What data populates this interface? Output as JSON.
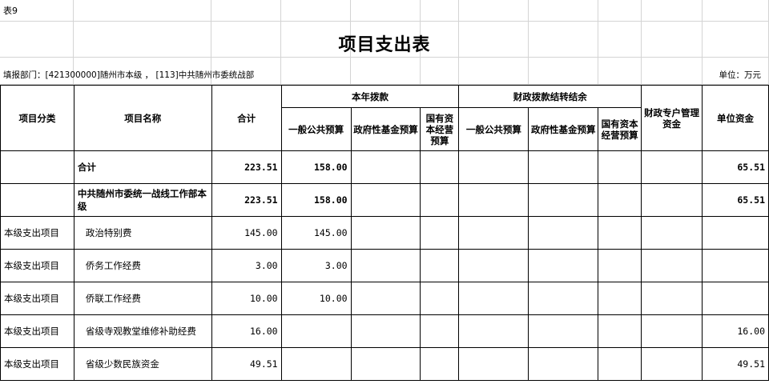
{
  "sheet_label": "表9",
  "title": "项目支出表",
  "dept": "填报部门：[421300000]随州市本级 ， [113]中共随州市委统战部",
  "unit": "单位：万元",
  "headers": {
    "category": "项目分类",
    "name": "项目名称",
    "total": "合计",
    "current_year": "本年拨款",
    "carryover": "财政拨款结转结余",
    "general": "一般公共预算",
    "gov_fund": "政府性基金预算",
    "state_capital": "国有资本经营预算",
    "special": "财政专户管理资金",
    "unit_funds": "单位资金"
  },
  "rows": [
    {
      "category": "",
      "name": "合计",
      "total": "223.51",
      "general": "158.00",
      "gov_fund": "",
      "state_capital": "",
      "co_general": "",
      "co_gov_fund": "",
      "co_state_capital": "",
      "special": "",
      "unit_funds": "65.51"
    },
    {
      "category": "",
      "name": "中共随州市委统一战线工作部本级",
      "total": "223.51",
      "general": "158.00",
      "gov_fund": "",
      "state_capital": "",
      "co_general": "",
      "co_gov_fund": "",
      "co_state_capital": "",
      "special": "",
      "unit_funds": "65.51"
    },
    {
      "category": "本级支出项目",
      "name": "政治特别费",
      "total": "145.00",
      "general": "145.00",
      "gov_fund": "",
      "state_capital": "",
      "co_general": "",
      "co_gov_fund": "",
      "co_state_capital": "",
      "special": "",
      "unit_funds": ""
    },
    {
      "category": "本级支出项目",
      "name": "侨务工作经费",
      "total": "3.00",
      "general": "3.00",
      "gov_fund": "",
      "state_capital": "",
      "co_general": "",
      "co_gov_fund": "",
      "co_state_capital": "",
      "special": "",
      "unit_funds": ""
    },
    {
      "category": "本级支出项目",
      "name": "侨联工作经费",
      "total": "10.00",
      "general": "10.00",
      "gov_fund": "",
      "state_capital": "",
      "co_general": "",
      "co_gov_fund": "",
      "co_state_capital": "",
      "special": "",
      "unit_funds": ""
    },
    {
      "category": "本级支出项目",
      "name": "省级寺观教堂维修补助经费",
      "total": "16.00",
      "general": "",
      "gov_fund": "",
      "state_capital": "",
      "co_general": "",
      "co_gov_fund": "",
      "co_state_capital": "",
      "special": "",
      "unit_funds": "16.00"
    },
    {
      "category": "本级支出项目",
      "name": "省级少数民族资金",
      "total": "49.51",
      "general": "",
      "gov_fund": "",
      "state_capital": "",
      "co_general": "",
      "co_gov_fund": "",
      "co_state_capital": "",
      "special": "",
      "unit_funds": "49.51"
    }
  ]
}
